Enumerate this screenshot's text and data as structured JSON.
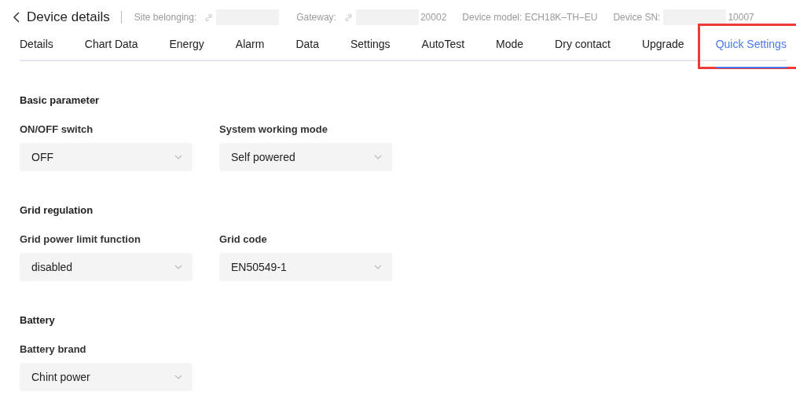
{
  "header": {
    "title": "Device details",
    "meta": [
      {
        "label": "Site belonging:",
        "link": true,
        "redacted": true
      },
      {
        "label": "Gateway:",
        "link": true,
        "redacted": true,
        "value": "20002"
      },
      {
        "label": "Device model: ECH18K–TH–EU",
        "link": false,
        "redacted": false
      },
      {
        "label": "Device SN:",
        "link": false,
        "redacted": true,
        "value": "10007"
      }
    ]
  },
  "tabs": [
    {
      "label": "Details",
      "selected": false,
      "highlighted": false
    },
    {
      "label": "Chart Data",
      "selected": false,
      "highlighted": false
    },
    {
      "label": "Energy",
      "selected": false,
      "highlighted": false
    },
    {
      "label": "Alarm",
      "selected": false,
      "highlighted": false
    },
    {
      "label": "Data",
      "selected": false,
      "highlighted": false
    },
    {
      "label": "Settings",
      "selected": false,
      "highlighted": false
    },
    {
      "label": "AutoTest",
      "selected": false,
      "highlighted": false
    },
    {
      "label": "Mode",
      "selected": false,
      "highlighted": false
    },
    {
      "label": "Dry contact",
      "selected": false,
      "highlighted": false
    },
    {
      "label": "Upgrade",
      "selected": false,
      "highlighted": false
    },
    {
      "label": "Quick Settings",
      "selected": true,
      "highlighted": true
    }
  ],
  "sections": [
    {
      "title": "Basic parameter",
      "fields": [
        {
          "label": "ON/OFF switch",
          "value": "OFF"
        },
        {
          "label": "System working mode",
          "value": "Self powered"
        }
      ]
    },
    {
      "title": "Grid regulation",
      "fields": [
        {
          "label": "Grid power limit function",
          "value": "disabled"
        },
        {
          "label": "Grid code",
          "value": "EN50549-1"
        }
      ]
    },
    {
      "title": "Battery",
      "fields": [
        {
          "label": "Battery brand",
          "value": "Chint power"
        }
      ]
    }
  ]
}
